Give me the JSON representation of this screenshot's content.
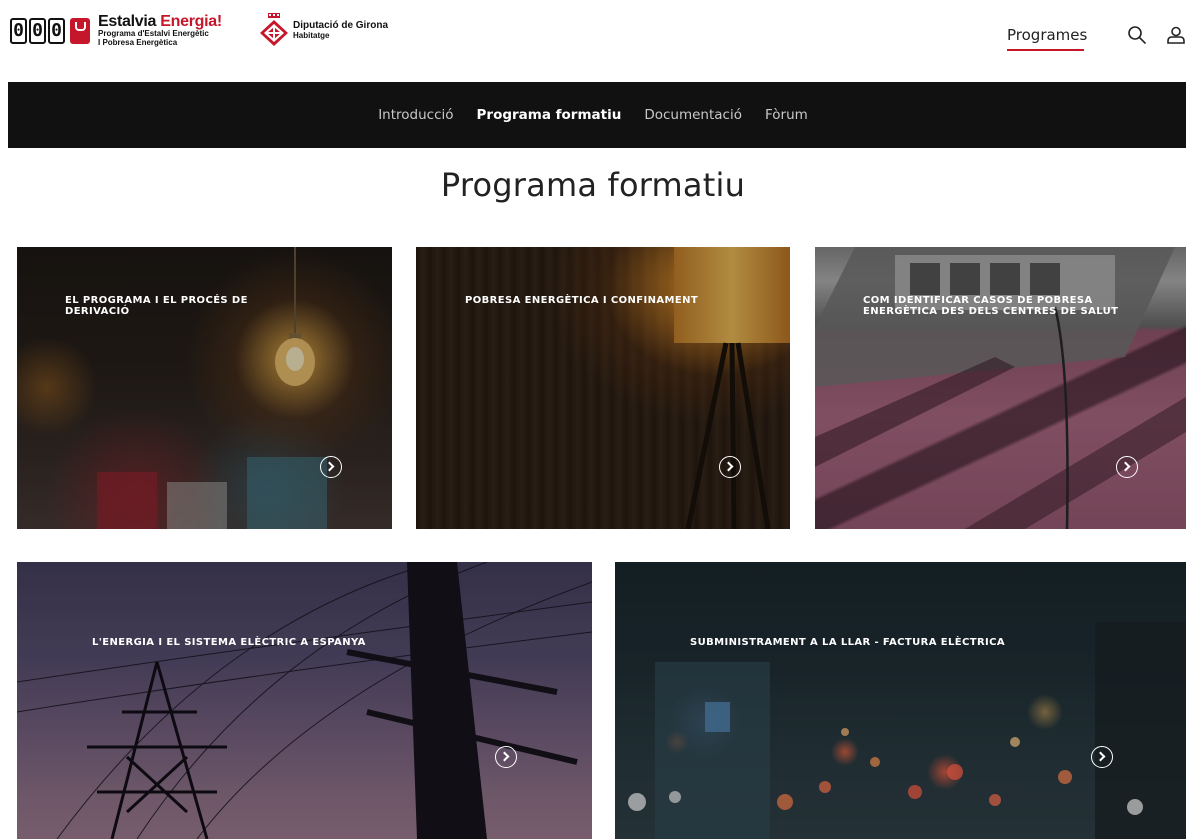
{
  "header": {
    "logo_estalvia": {
      "digits": [
        "0",
        "0",
        "0"
      ],
      "brand_part1": "Estalvia",
      "brand_part2": "Energia!",
      "subtitle_line1": "Programa d'Estalvi Energètic",
      "subtitle_line2": "I Pobresa Energètica"
    },
    "logo_diputacio": {
      "title": "Diputació de Girona",
      "subtitle": "Habitatge"
    },
    "nav_programes": "Programes",
    "accent_color": "#c6172a"
  },
  "subnav": {
    "items": [
      {
        "label": "Introducció",
        "active": false
      },
      {
        "label": "Programa formatiu",
        "active": true
      },
      {
        "label": "Documentació",
        "active": false
      },
      {
        "label": "Fòrum",
        "active": false
      }
    ]
  },
  "page_title": "Programa formatiu",
  "cards": [
    {
      "title": "EL PROGRAMA I EL PROCÉS DE DERIVACIÓ"
    },
    {
      "title": "POBRESA ENERGÈTICA I CONFINAMENT"
    },
    {
      "title": "COM IDENTIFICAR CASOS DE POBRESA ENERGÈTICA DES DELS CENTRES DE SALUT"
    },
    {
      "title": "L'ENERGIA I EL SISTEMA ELÈCTRIC A ESPANYA"
    },
    {
      "title": "SUBMINISTRAMENT A LA LLAR - FACTURA ELÈCTRICA"
    }
  ],
  "icons": {
    "search": "search-icon",
    "user": "user-icon",
    "card_arrow": "chevron-right-circle-icon"
  }
}
